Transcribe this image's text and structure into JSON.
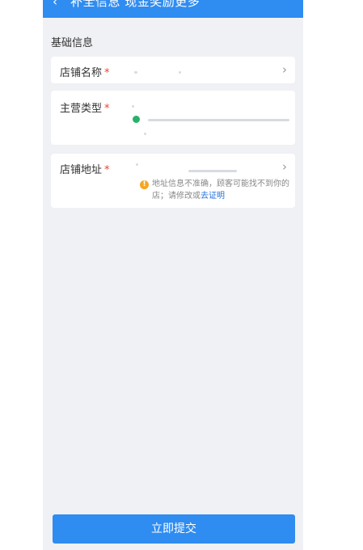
{
  "header": {
    "back_icon": "chevron-left-icon",
    "title": "补全信息 现金奖励更多"
  },
  "section": {
    "title": "基础信息"
  },
  "fields": {
    "store_name": {
      "label": "店铺名称",
      "required_mark": "*"
    },
    "main_category": {
      "label": "主营类型",
      "required_mark": "*"
    },
    "store_address": {
      "label": "店铺地址",
      "required_mark": "*"
    }
  },
  "address_warning": {
    "icon": "warning-icon",
    "text": "地址信息不准确，顾客可能找不到你的店；请修改或",
    "link": "去证明"
  },
  "submit": {
    "label": "立即提交"
  },
  "colors": {
    "accent": "#2f8cf0",
    "required": "#e6452e",
    "warning": "#f5a623",
    "link": "#1e6fdc"
  }
}
